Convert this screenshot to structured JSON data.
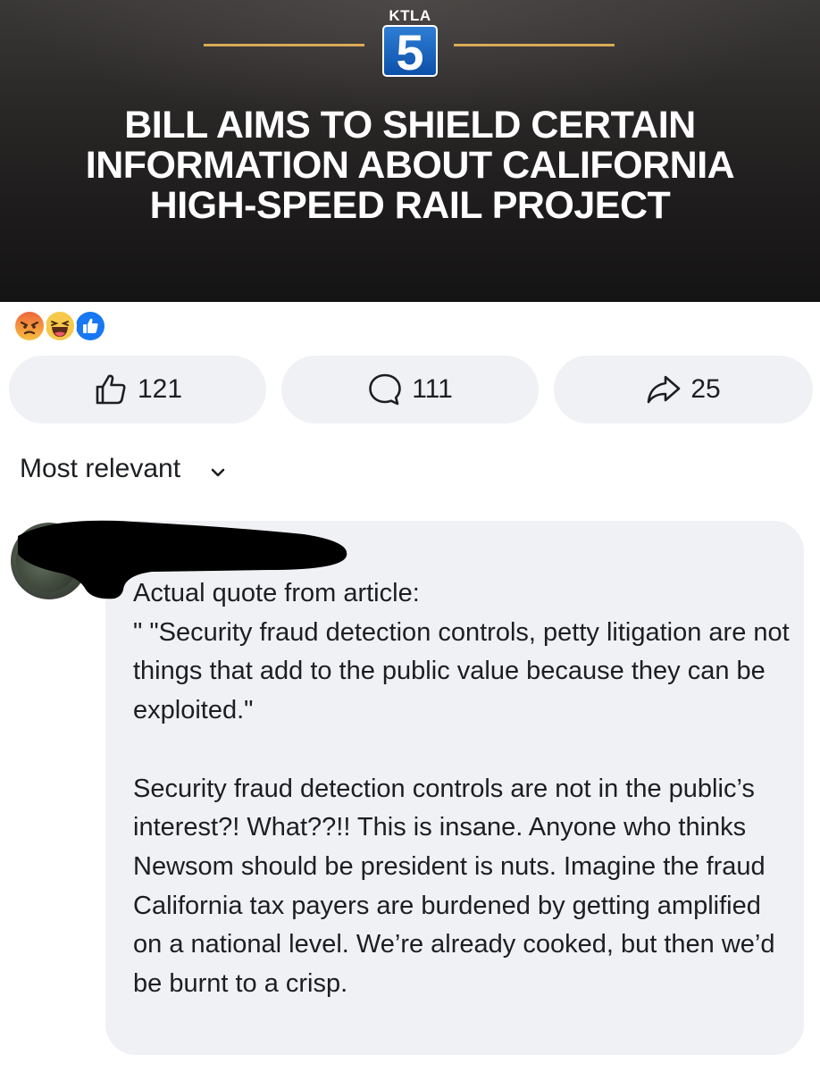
{
  "banner": {
    "logo_wordmark": "KTLA",
    "logo_number": "5",
    "headline": "BILL AIMS TO SHIELD CERTAIN\nINFORMATION ABOUT CALIFORNIA\nHIGH-SPEED RAIL PROJECT",
    "accent_color": "#d9aa55"
  },
  "reactions": [
    "angry-icon",
    "haha-icon",
    "like-icon"
  ],
  "actions": {
    "like_count": "121",
    "comment_count": "111",
    "share_count": "25"
  },
  "sort": {
    "label": "Most relevant"
  },
  "comment": {
    "author_name": "",
    "text": "Actual quote from article:\n\" \"Security fraud detection controls, petty litigation are not things that add to the public value because they can be exploited.\"\n\nSecurity fraud detection controls are not in the public’s interest?! What??!!  This is insane. Anyone who thinks Newsom should be president is nuts. Imagine the fraud California tax payers are burdened by getting amplified on a national level. We’re already cooked, but then we’d be burnt to a crisp."
  },
  "colors": {
    "pill_bg": "#f0f1f5",
    "bubble_bg": "#f0f1f5",
    "like_blue": "#1877f2"
  }
}
